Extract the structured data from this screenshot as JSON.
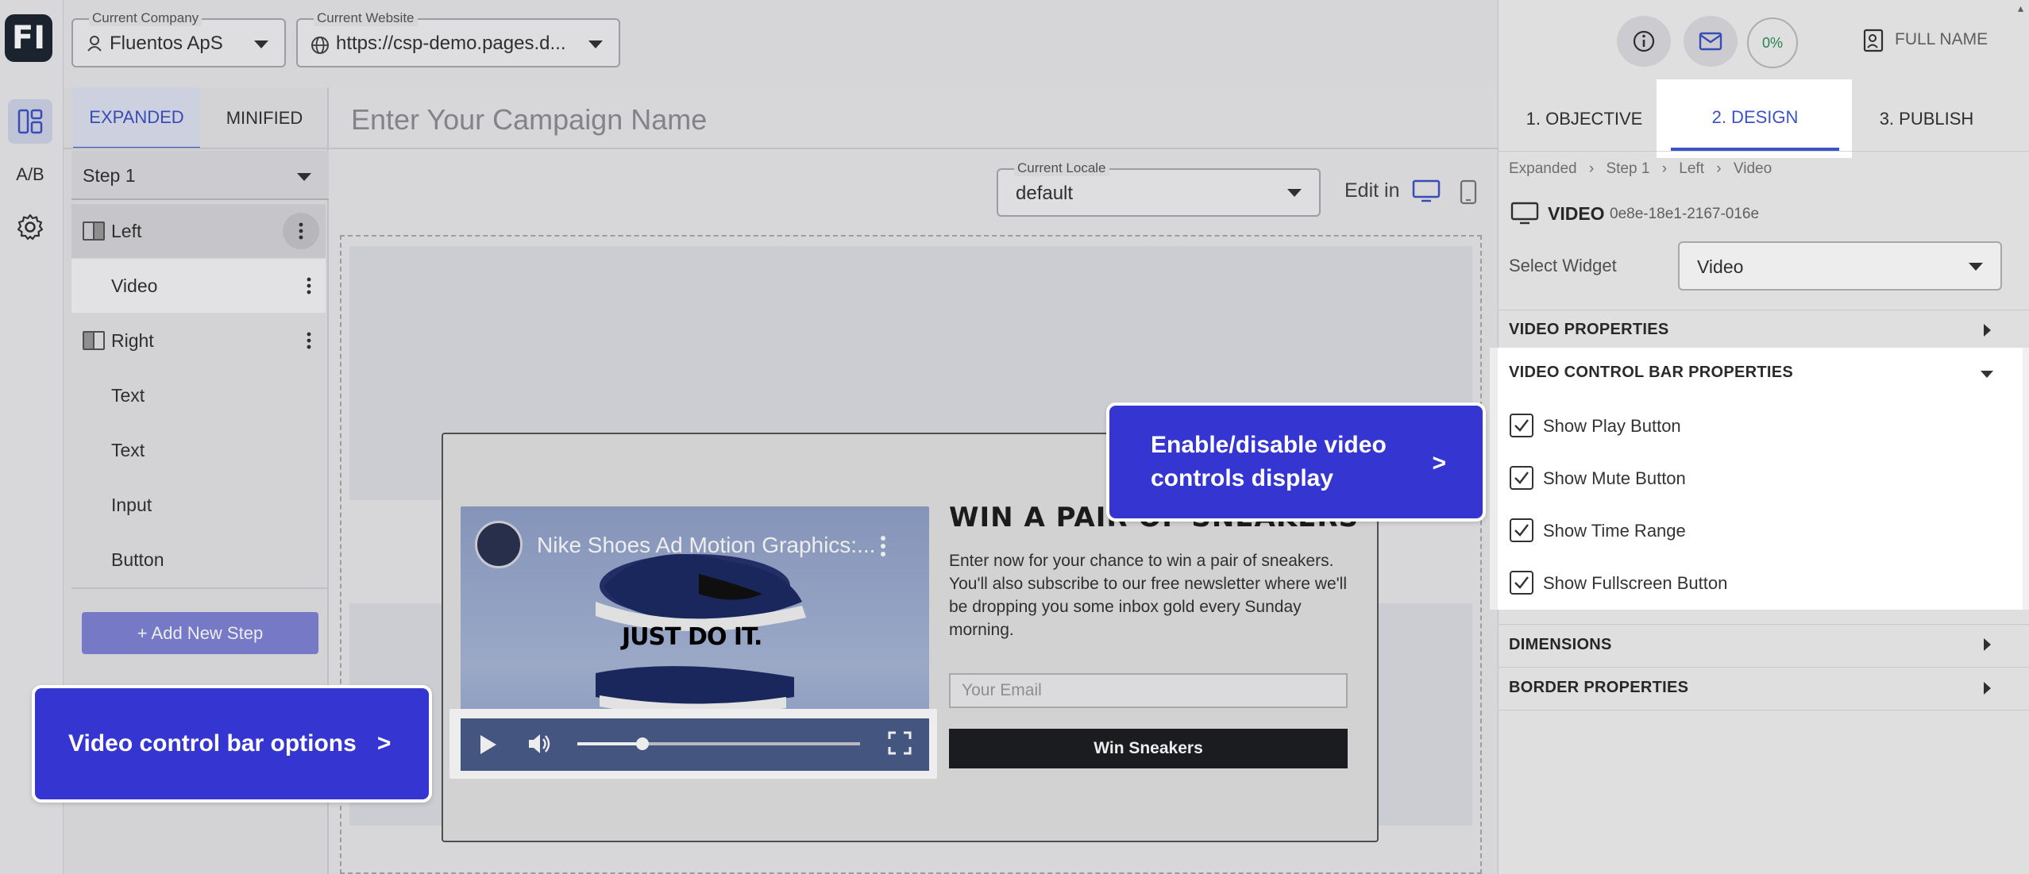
{
  "app": {
    "logo_text": "FI"
  },
  "rail": {
    "ab_label": "A/B"
  },
  "header": {
    "company": {
      "label": "Current Company",
      "value": "Fluentos ApS"
    },
    "website": {
      "label": "Current Website",
      "value": "https://csp-demo.pages.d..."
    },
    "progress": "0%",
    "user_name": "FULL NAME"
  },
  "left_panel": {
    "tabs": [
      "EXPANDED",
      "MINIFIED"
    ],
    "active_tab": "EXPANDED",
    "step_select": "Step 1",
    "tree": [
      {
        "label": "Left",
        "type": "column"
      },
      {
        "label": "Video",
        "type": "child"
      },
      {
        "label": "Right",
        "type": "column"
      },
      {
        "label": "Text",
        "type": "child"
      },
      {
        "label": "Text",
        "type": "child"
      },
      {
        "label": "Input",
        "type": "child"
      },
      {
        "label": "Button",
        "type": "child"
      }
    ],
    "add_step": "+ Add New Step"
  },
  "canvas": {
    "campaign_placeholder": "Enter Your Campaign Name",
    "locale": {
      "label": "Current Locale",
      "value": "default"
    },
    "edit_in": "Edit in"
  },
  "popup": {
    "video_title": "Nike Shoes Ad Motion Graphics:...",
    "video_slogan": "JUST DO IT.",
    "heading": "WIN A PAIR OF SNEAKERS",
    "body": "Enter now for your chance to win a pair of sneakers. You'll also subscribe to our free newsletter where we'll be dropping you some inbox gold every Sunday morning.",
    "email_placeholder": "Your Email",
    "button": "Win Sneakers",
    "video_progress_fraction": 0.23
  },
  "right_panel": {
    "tabs": [
      "1. OBJECTIVE",
      "2. DESIGN",
      "3. PUBLISH"
    ],
    "active_tab": "2. DESIGN",
    "breadcrumb": [
      "Expanded",
      "Step 1",
      "Left",
      "Video"
    ],
    "widget_type": "VIDEO",
    "widget_id": "0e8e-18e1-2167-016e",
    "select_widget_label": "Select Widget",
    "select_widget_value": "Video",
    "sections": {
      "video_properties": "VIDEO PROPERTIES",
      "control_bar": "VIDEO CONTROL BAR PROPERTIES",
      "dimensions": "DIMENSIONS",
      "border": "BORDER PROPERTIES"
    },
    "checkboxes": [
      {
        "label": "Show Play Button",
        "checked": true
      },
      {
        "label": "Show Mute Button",
        "checked": true
      },
      {
        "label": "Show Time Range",
        "checked": true
      },
      {
        "label": "Show Fullscreen Button",
        "checked": true
      }
    ]
  },
  "callouts": {
    "left": {
      "text": "Video control bar options",
      "arrow": ">"
    },
    "right": {
      "line1": "Enable/disable video",
      "line2": "controls display",
      "arrow": ">"
    }
  },
  "colors": {
    "accent": "#3535d2",
    "tab_active": "#3d52c4",
    "dark": "#1e2632"
  }
}
